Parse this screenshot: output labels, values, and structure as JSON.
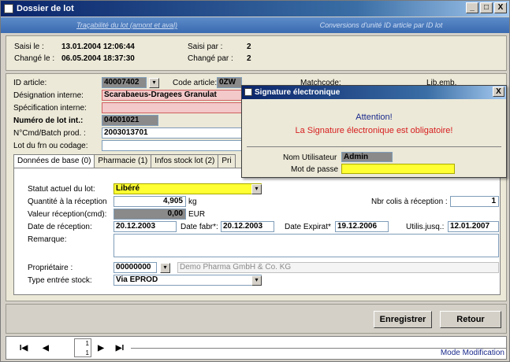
{
  "window": {
    "title": "Dossier de lot",
    "controls": [
      "_",
      "□",
      "X"
    ]
  },
  "toptabs": {
    "left": "Traçabilité du lot (amont et aval)",
    "right": "Conversions d'unité ID article par ID lot"
  },
  "audit": {
    "saisi_label": "Saisi le :",
    "saisi_value": "13.01.2004 12:06:44",
    "saisi_par_label": "Saisi par :",
    "saisi_par_value": "2",
    "change_label": "Changé le :",
    "change_value": "06.05.2004 18:37:30",
    "change_par_label": "Changé par :",
    "change_par_value": "2"
  },
  "article": {
    "id_label": "ID article:",
    "id_value": "40007402",
    "code_label": "Code article:",
    "code_value": "0ZW",
    "match_label": "Matchcode:",
    "lib_label": "Lib.emb.",
    "designation_label": "Désignation interne:",
    "designation_value": "Scarabaeus-Dragees Granulat",
    "spec_label": "Spécification interne:",
    "lot_label": "Numéro de lot int.:",
    "lot_value": "04001021",
    "cmd_label": "N°Cmd/Batch prod. :",
    "cmd_value": "2003013701",
    "frn_label": "Lot du frn ou codage:"
  },
  "tabs": [
    {
      "label": "Données de base (0)",
      "active": true
    },
    {
      "label": "Pharmacie (1)",
      "active": false
    },
    {
      "label": "Infos stock lot (2)",
      "active": false
    },
    {
      "label": "Pri",
      "active": false
    }
  ],
  "base": {
    "statut_label": "Statut actuel du lot:",
    "statut_value": "Libéré",
    "qte_label": "Quantité à la réception",
    "qte_value": "4,905",
    "qte_unit": "kg",
    "colis_label": "Nbr colis à réception :",
    "colis_value": "1",
    "valeur_label": "Valeur réception(cmd):",
    "valeur_value": "0,00",
    "valeur_unit": "EUR",
    "date_rec_label": "Date de réception:",
    "date_rec_value": "20.12.2003",
    "date_fabr_label": "Date fabr*:",
    "date_fabr_value": "20.12.2003",
    "date_exp_label": "Date Expirat*",
    "date_exp_value": "19.12.2006",
    "util_label": "Utilis.jusq.:",
    "util_value": "12.01.2007",
    "remarque_label": "Remarque:",
    "proprio_label": "Propriétaire :",
    "proprio_value": "00000000",
    "proprio_name": "Demo Pharma GmbH & Co. KG",
    "type_label": "Type entrée stock:",
    "type_value": "Via EPROD"
  },
  "buttons": {
    "save": "Enregistrer",
    "back": "Retour"
  },
  "nav": {
    "current": "1",
    "total": "1",
    "mode": "Mode Modification"
  },
  "dialog": {
    "title": "Signature électronique",
    "close": "X",
    "attention": "Attention!",
    "message": "La Signature électronique est obligatoire!",
    "user_label": "Nom Utilisateur",
    "user_value": "Admin",
    "pass_label": "Mot de passe",
    "pass_value": ""
  },
  "colors": {
    "title_bar": "#0a246a",
    "highlight_yellow": "#ffff33",
    "message_red": "#d62020",
    "attention_blue": "#1a2a8c"
  }
}
